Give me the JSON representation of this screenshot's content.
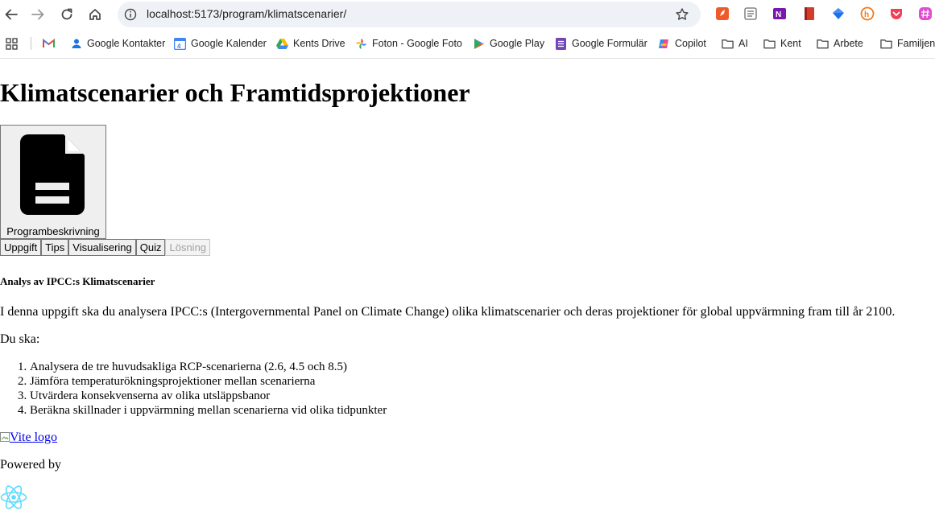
{
  "browser": {
    "url": "localhost:5173/program/klimatscenarier/",
    "bookmarks": [
      {
        "label": "",
        "icon": "gmail-icon"
      },
      {
        "label": "Google Kontakter",
        "icon": "contacts-icon"
      },
      {
        "label": "Google Kalender",
        "icon": "calendar-icon"
      },
      {
        "label": "Kents Drive",
        "icon": "drive-icon"
      },
      {
        "label": "Foton - Google Foto",
        "icon": "photos-icon"
      },
      {
        "label": "Google Play",
        "icon": "play-icon"
      },
      {
        "label": "Google Formulär",
        "icon": "forms-icon"
      },
      {
        "label": "Copilot",
        "icon": "copilot-icon"
      },
      {
        "label": "AI",
        "icon": "folder-icon"
      },
      {
        "label": "Kent",
        "icon": "folder-icon"
      },
      {
        "label": "Arbete",
        "icon": "folder-icon"
      },
      {
        "label": "Familjen",
        "icon": "folder-icon"
      }
    ]
  },
  "page": {
    "title": "Klimatscenarier och Framtidsprojektioner",
    "program_button_label": "Programbeskrivning",
    "tabs": [
      {
        "label": "Uppgift",
        "enabled": true
      },
      {
        "label": "Tips",
        "enabled": true
      },
      {
        "label": "Visualisering",
        "enabled": true
      },
      {
        "label": "Quiz",
        "enabled": true
      },
      {
        "label": "Lösning",
        "enabled": false
      }
    ],
    "section_heading": "Analys av IPCC:s Klimatscenarier",
    "intro": "I denna uppgift ska du analysera IPCC:s (Intergovernmental Panel on Climate Change) olika klimatscenarier och deras projektioner för global uppvärmning fram till år 2100.",
    "du_ska": "Du ska:",
    "steps": [
      "Analysera de tre huvudsakliga RCP-scenarierna (2.6, 4.5 och 8.5)",
      "Jämföra temperaturökningsprojektioner mellan scenarierna",
      "Utvärdera konsekvenserna av olika utsläppsbanor",
      "Beräkna skillnader i uppvärmning mellan scenarierna vid olika tidpunkter"
    ],
    "vite_alt": "Vite logo",
    "powered_by": "Powered by"
  }
}
